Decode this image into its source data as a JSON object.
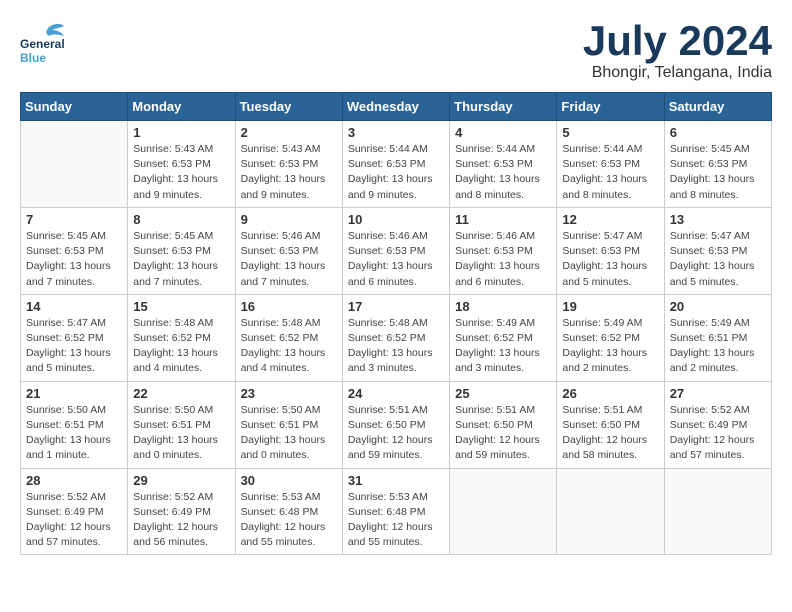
{
  "header": {
    "logo_general": "General",
    "logo_blue": "Blue",
    "month": "July 2024",
    "location": "Bhongir, Telangana, India"
  },
  "weekdays": [
    "Sunday",
    "Monday",
    "Tuesday",
    "Wednesday",
    "Thursday",
    "Friday",
    "Saturday"
  ],
  "weeks": [
    [
      {
        "day": "",
        "info": ""
      },
      {
        "day": "1",
        "info": "Sunrise: 5:43 AM\nSunset: 6:53 PM\nDaylight: 13 hours\nand 9 minutes."
      },
      {
        "day": "2",
        "info": "Sunrise: 5:43 AM\nSunset: 6:53 PM\nDaylight: 13 hours\nand 9 minutes."
      },
      {
        "day": "3",
        "info": "Sunrise: 5:44 AM\nSunset: 6:53 PM\nDaylight: 13 hours\nand 9 minutes."
      },
      {
        "day": "4",
        "info": "Sunrise: 5:44 AM\nSunset: 6:53 PM\nDaylight: 13 hours\nand 8 minutes."
      },
      {
        "day": "5",
        "info": "Sunrise: 5:44 AM\nSunset: 6:53 PM\nDaylight: 13 hours\nand 8 minutes."
      },
      {
        "day": "6",
        "info": "Sunrise: 5:45 AM\nSunset: 6:53 PM\nDaylight: 13 hours\nand 8 minutes."
      }
    ],
    [
      {
        "day": "7",
        "info": "Sunrise: 5:45 AM\nSunset: 6:53 PM\nDaylight: 13 hours\nand 7 minutes."
      },
      {
        "day": "8",
        "info": "Sunrise: 5:45 AM\nSunset: 6:53 PM\nDaylight: 13 hours\nand 7 minutes."
      },
      {
        "day": "9",
        "info": "Sunrise: 5:46 AM\nSunset: 6:53 PM\nDaylight: 13 hours\nand 7 minutes."
      },
      {
        "day": "10",
        "info": "Sunrise: 5:46 AM\nSunset: 6:53 PM\nDaylight: 13 hours\nand 6 minutes."
      },
      {
        "day": "11",
        "info": "Sunrise: 5:46 AM\nSunset: 6:53 PM\nDaylight: 13 hours\nand 6 minutes."
      },
      {
        "day": "12",
        "info": "Sunrise: 5:47 AM\nSunset: 6:53 PM\nDaylight: 13 hours\nand 5 minutes."
      },
      {
        "day": "13",
        "info": "Sunrise: 5:47 AM\nSunset: 6:53 PM\nDaylight: 13 hours\nand 5 minutes."
      }
    ],
    [
      {
        "day": "14",
        "info": "Sunrise: 5:47 AM\nSunset: 6:52 PM\nDaylight: 13 hours\nand 5 minutes."
      },
      {
        "day": "15",
        "info": "Sunrise: 5:48 AM\nSunset: 6:52 PM\nDaylight: 13 hours\nand 4 minutes."
      },
      {
        "day": "16",
        "info": "Sunrise: 5:48 AM\nSunset: 6:52 PM\nDaylight: 13 hours\nand 4 minutes."
      },
      {
        "day": "17",
        "info": "Sunrise: 5:48 AM\nSunset: 6:52 PM\nDaylight: 13 hours\nand 3 minutes."
      },
      {
        "day": "18",
        "info": "Sunrise: 5:49 AM\nSunset: 6:52 PM\nDaylight: 13 hours\nand 3 minutes."
      },
      {
        "day": "19",
        "info": "Sunrise: 5:49 AM\nSunset: 6:52 PM\nDaylight: 13 hours\nand 2 minutes."
      },
      {
        "day": "20",
        "info": "Sunrise: 5:49 AM\nSunset: 6:51 PM\nDaylight: 13 hours\nand 2 minutes."
      }
    ],
    [
      {
        "day": "21",
        "info": "Sunrise: 5:50 AM\nSunset: 6:51 PM\nDaylight: 13 hours\nand 1 minute."
      },
      {
        "day": "22",
        "info": "Sunrise: 5:50 AM\nSunset: 6:51 PM\nDaylight: 13 hours\nand 0 minutes."
      },
      {
        "day": "23",
        "info": "Sunrise: 5:50 AM\nSunset: 6:51 PM\nDaylight: 13 hours\nand 0 minutes."
      },
      {
        "day": "24",
        "info": "Sunrise: 5:51 AM\nSunset: 6:50 PM\nDaylight: 12 hours\nand 59 minutes."
      },
      {
        "day": "25",
        "info": "Sunrise: 5:51 AM\nSunset: 6:50 PM\nDaylight: 12 hours\nand 59 minutes."
      },
      {
        "day": "26",
        "info": "Sunrise: 5:51 AM\nSunset: 6:50 PM\nDaylight: 12 hours\nand 58 minutes."
      },
      {
        "day": "27",
        "info": "Sunrise: 5:52 AM\nSunset: 6:49 PM\nDaylight: 12 hours\nand 57 minutes."
      }
    ],
    [
      {
        "day": "28",
        "info": "Sunrise: 5:52 AM\nSunset: 6:49 PM\nDaylight: 12 hours\nand 57 minutes."
      },
      {
        "day": "29",
        "info": "Sunrise: 5:52 AM\nSunset: 6:49 PM\nDaylight: 12 hours\nand 56 minutes."
      },
      {
        "day": "30",
        "info": "Sunrise: 5:53 AM\nSunset: 6:48 PM\nDaylight: 12 hours\nand 55 minutes."
      },
      {
        "day": "31",
        "info": "Sunrise: 5:53 AM\nSunset: 6:48 PM\nDaylight: 12 hours\nand 55 minutes."
      },
      {
        "day": "",
        "info": ""
      },
      {
        "day": "",
        "info": ""
      },
      {
        "day": "",
        "info": ""
      }
    ]
  ]
}
